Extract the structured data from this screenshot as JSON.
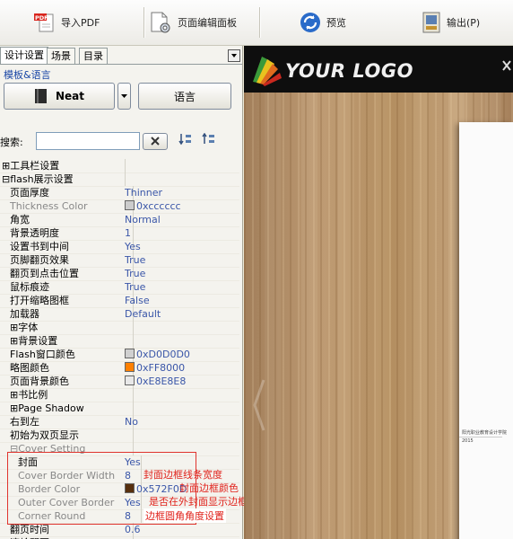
{
  "toolbar": {
    "import_pdf": "导入PDF",
    "page_editor": "页面编辑面板",
    "preview": "预览",
    "export": "输出(P)"
  },
  "tabs": [
    "设计设置",
    "场景",
    "目录"
  ],
  "template_group_label": "模板&语言",
  "theme_button": "Neat",
  "language_button": "语言",
  "search": {
    "label": "搜索:",
    "value": ""
  },
  "properties": [
    {
      "key": "⊞工具栏设置",
      "value": "",
      "type": "cat",
      "indent": 0
    },
    {
      "key": "⊟flash展示设置",
      "value": "",
      "type": "cat",
      "indent": 0
    },
    {
      "key": "页面厚度",
      "value": "Thinner",
      "indent": 1
    },
    {
      "key": "Thickness Color",
      "value": "0xcccccc",
      "swatch": "#cccccc",
      "indent": 1,
      "gray": true
    },
    {
      "key": "角宽",
      "value": "Normal",
      "indent": 1
    },
    {
      "key": "背景透明度",
      "value": "1",
      "indent": 1
    },
    {
      "key": "设置书到中间",
      "value": "Yes",
      "indent": 1
    },
    {
      "key": "页脚翻页效果",
      "value": "True",
      "indent": 1
    },
    {
      "key": "翻页到点击位置",
      "value": "True",
      "indent": 1
    },
    {
      "key": "鼠标痕迹",
      "value": "True",
      "indent": 1
    },
    {
      "key": "打开缩略图框",
      "value": "False",
      "indent": 1
    },
    {
      "key": "加载器",
      "value": "Default",
      "indent": 1
    },
    {
      "key": "⊞字体",
      "value": "",
      "type": "cat",
      "indent": 1
    },
    {
      "key": "⊞背景设置",
      "value": "",
      "type": "cat",
      "indent": 1
    },
    {
      "key": "Flash窗口颜色",
      "value": "0xD0D0D0",
      "swatch": "#D0D0D0",
      "indent": 1
    },
    {
      "key": "略图颜色",
      "value": "0xFF8000",
      "swatch": "#FF8000",
      "indent": 1
    },
    {
      "key": "页面背景颜色",
      "value": "0xE8E8E8",
      "swatch": "#E8E8E8",
      "indent": 1
    },
    {
      "key": "⊞书比例",
      "value": "",
      "type": "cat",
      "indent": 1
    },
    {
      "key": "⊞Page Shadow",
      "value": "",
      "type": "cat",
      "indent": 1
    },
    {
      "key": "右到左",
      "value": "No",
      "indent": 1
    },
    {
      "key": "初始为双页显示",
      "value": "",
      "indent": 1
    },
    {
      "key": "⊟Cover Setting",
      "value": "",
      "type": "cat",
      "indent": 1,
      "gray": true
    },
    {
      "key": "封面",
      "value": "Yes",
      "indent": 2
    },
    {
      "key": "Cover Border Width",
      "value": "8",
      "indent": 2,
      "gray": true
    },
    {
      "key": "Border Color",
      "value": "0x572F0D",
      "swatch": "#572F0D",
      "indent": 2,
      "gray": true
    },
    {
      "key": "Outer Cover Border",
      "value": "Yes",
      "indent": 2,
      "gray": true
    },
    {
      "key": "Corner Round",
      "value": "8",
      "indent": 2,
      "gray": true
    },
    {
      "key": "翻页时间",
      "value": "0.6",
      "indent": 1
    },
    {
      "key": "滚轮翻页",
      "value": "Yes",
      "indent": 1
    }
  ],
  "annotations": {
    "cover_border_width": "封面边框线条宽度",
    "border_color": "封面边框颜色",
    "outer_cover_border": "是否在外封面显示边框",
    "corner_round": "边框圆角角度设置"
  },
  "preview": {
    "logo_text": "YOUR LOGO",
    "page_caption": "阳光职业教育设计学院",
    "page_caption2": "2015"
  },
  "colors": {
    "accent": "#1a47a6",
    "annotation": "#e0221b",
    "logo_bar": "#0e0e0e"
  }
}
